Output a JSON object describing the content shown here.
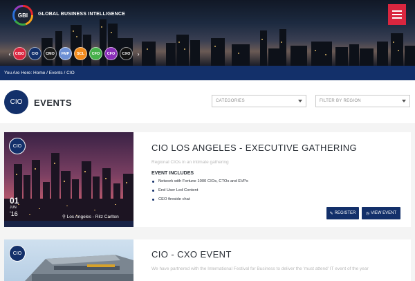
{
  "header": {
    "logo_text": "GBI",
    "brand": "GLOBAL BUSINESS INTELLIGENCE",
    "nav_circles": [
      {
        "label": "CISO",
        "color": "#d9263f"
      },
      {
        "label": "CIO",
        "color": "#13306a"
      },
      {
        "label": "CMO",
        "color": "#1b1b1b"
      },
      {
        "label": "FMP",
        "color": "#6c8fd4"
      },
      {
        "label": "SCL",
        "color": "#f08a1c"
      },
      {
        "label": "CFO",
        "color": "#46b04a"
      },
      {
        "label": "CFO",
        "color": "#8a2fb8"
      },
      {
        "label": "CXO",
        "color": "#111111"
      }
    ],
    "prev_arrow": "‹",
    "next_arrow": "›"
  },
  "breadcrumb": "You Are Here: Home / Events / CIO",
  "page": {
    "badge": "CIO",
    "title": "EVENTS",
    "categories_placeholder": "CATEGORIES",
    "region_placeholder": "FILTER BY REGION"
  },
  "events": [
    {
      "badge": "CIO",
      "day": "01",
      "month": "JUN",
      "year": "'16",
      "location": "Los Angeles - Ritz Carlton",
      "title": "CIO LOS ANGELES - EXECUTIVE GATHERING",
      "subtitle": "Regional CIOs in an intimate gathering",
      "includes_label": "EVENT INCLUDES",
      "bullets": [
        "Network with Fortune 1000 CIOs, CTOs and EVPs",
        "End User Led Content",
        "CEO fireside chat"
      ],
      "register_label": "REGISTER",
      "view_label": "VIEW EVENT"
    },
    {
      "badge": "CIO",
      "title": "CIO - CXO EVENT",
      "description": "We have partnered with the International Festival for Business to deliver the 'must attend' IT event of the year"
    }
  ],
  "colors": {
    "navy": "#13306a",
    "menu_red": "#d9263f"
  }
}
